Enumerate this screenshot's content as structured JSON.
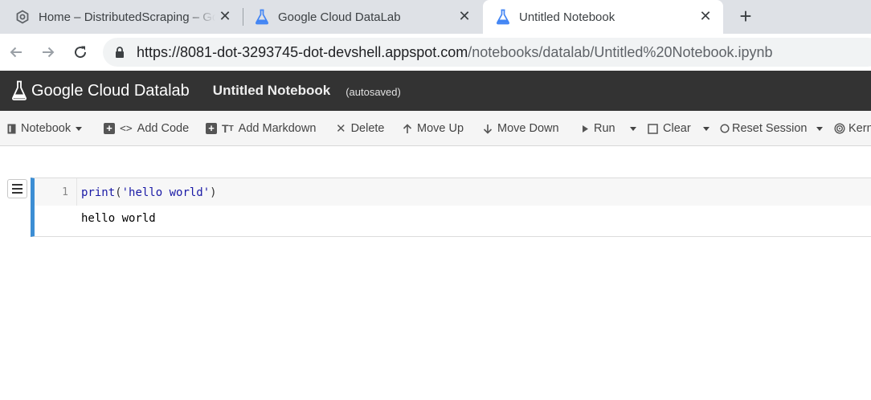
{
  "browser": {
    "tabs": [
      {
        "label": "Home – DistributedScraping – Google Cloud Platform",
        "icon": "gcp-hexagon-icon"
      },
      {
        "label": "Google Cloud DataLab",
        "icon": "flask-icon"
      },
      {
        "label": "Untitled Notebook",
        "icon": "flask-icon"
      }
    ],
    "url_host": "https://8081-dot-3293745-dot-devshell.appspot.com",
    "url_path": "/notebooks/datalab/Untitled%20Notebook.ipynb"
  },
  "datalab": {
    "brand": "Google Cloud Datalab",
    "notebook_title": "Untitled Notebook",
    "save_status": "(autosaved)"
  },
  "toolbar": {
    "notebook": "Notebook",
    "add_code": "Add Code",
    "add_markdown": "Add Markdown",
    "delete": "Delete",
    "move_up": "Move Up",
    "move_down": "Move Down",
    "run": "Run",
    "clear": "Clear",
    "reset_session": "Reset Session",
    "kernel": "Kernel"
  },
  "cell": {
    "line_number": "1",
    "code_fn": "print",
    "code_open": "(",
    "code_str": "'hello world'",
    "code_close": ")",
    "output": "hello world"
  },
  "colors": {
    "header_bg": "#333333",
    "cell_accent": "#3c8ed4"
  }
}
